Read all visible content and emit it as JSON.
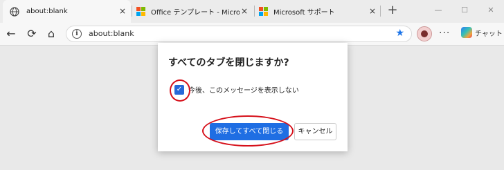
{
  "tabs": [
    {
      "label": "about:blank",
      "close": "×",
      "icon": "globe-icon"
    },
    {
      "label": "Office テンプレート - Microsoft",
      "close": "×",
      "icon": "microsoft-logo-icon"
    },
    {
      "label": "Microsoft サポート",
      "close": "×",
      "icon": "microsoft-logo-icon"
    }
  ],
  "new_tab": "+",
  "window_controls": {
    "minimize": "—",
    "maximize": "☐",
    "close": "✕"
  },
  "toolbar": {
    "back": "←",
    "refresh": "⟳",
    "home": "⌂",
    "url": "about:blank",
    "more": "···",
    "chat_label": "チャット"
  },
  "dialog": {
    "title": "すべてのタブを閉じますか?",
    "checkbox_label": "今後、このメッセージを表示しない",
    "checkbox_checked": true,
    "primary_button": "保存してすべて閉じる",
    "cancel_button": "キャンセル"
  },
  "colors": {
    "accent": "#1f6ee3",
    "annotation": "#d6101a"
  }
}
